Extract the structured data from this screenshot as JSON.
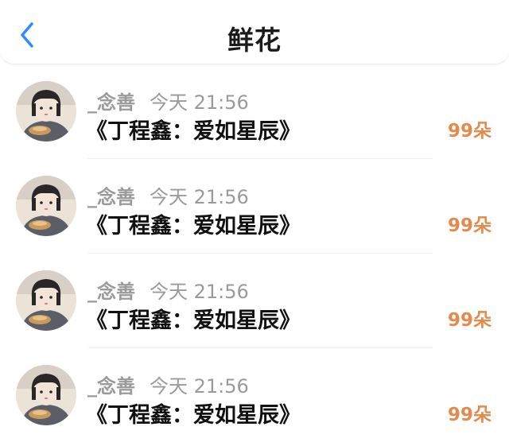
{
  "header": {
    "title": "鲜花",
    "back_icon": "chevron-left-icon",
    "accent_color": "#2f8cff"
  },
  "items": [
    {
      "user": "_念善",
      "time": "今天 21:56",
      "book": "《丁程鑫：爱如星辰》",
      "amount": "99朵"
    },
    {
      "user": "_念善",
      "time": "今天 21:56",
      "book": "《丁程鑫：爱如星辰》",
      "amount": "99朵"
    },
    {
      "user": "_念善",
      "time": "今天 21:56",
      "book": "《丁程鑫：爱如星辰》",
      "amount": "99朵"
    },
    {
      "user": "_念善",
      "time": "今天 21:56",
      "book": "《丁程鑫：爱如星辰》",
      "amount": "99朵"
    }
  ],
  "amount_color": "#e38a4d"
}
